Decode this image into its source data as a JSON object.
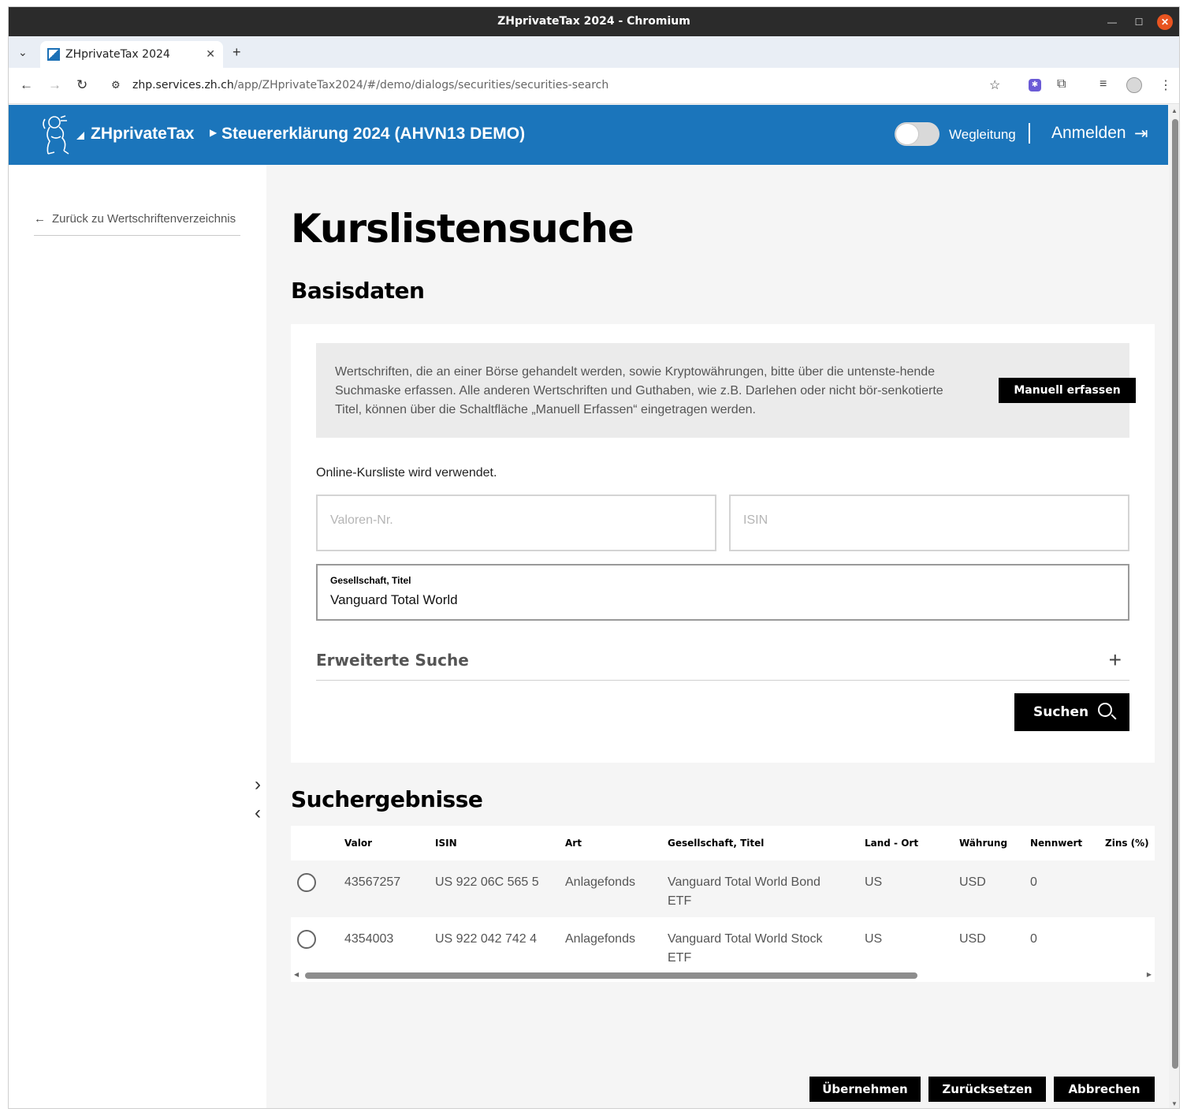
{
  "window": {
    "title": "ZHprivateTax 2024 - Chromium"
  },
  "browser": {
    "tab_title": "ZHprivateTax 2024",
    "url_host": "zhp.services.zh.ch",
    "url_path": "/app/ZHprivateTax2024/#/demo/dialogs/securities/securities-search"
  },
  "header": {
    "brand": "ZHprivateTax",
    "breadcrumb": "Steuererklärung 2024 (AHVN13 DEMO)",
    "wegleitung": "Wegleitung",
    "login": "Anmelden"
  },
  "sidebar": {
    "back_link": "Zurück zu Wertschriftenverzeichnis"
  },
  "main": {
    "title": "Kurslistensuche",
    "basis_heading": "Basisdaten",
    "info_text": "Wertschriften, die an einer Börse gehandelt werden, sowie Kryptowährungen, bitte über die untenste-hende Suchmaske erfassen. Alle anderen Wertschriften und Guthaben, wie z.B. Darlehen oder nicht bör-senkotierte Titel, können über die Schaltfläche „Manuell Erfassen“ eingetragen werden.",
    "manuell_button": "Manuell erfassen",
    "kursliste_note": "Online-Kursliste wird verwendet.",
    "valor_placeholder": "Valoren-Nr.",
    "isin_placeholder": "ISIN",
    "company_label": "Gesellschaft, Titel",
    "company_value": "Vanguard Total World",
    "advanced_search": "Erweiterte Suche",
    "search_button": "Suchen",
    "results_heading": "Suchergebnisse"
  },
  "results": {
    "columns": [
      "Valor",
      "ISIN",
      "Art",
      "Gesellschaft, Titel",
      "Land - Ort",
      "Währung",
      "Nennwert",
      "Zins (%)"
    ],
    "rows": [
      {
        "valor": "43567257",
        "isin": "US 922 06C 565 5",
        "art": "Anlagefonds",
        "title_line1": "Vanguard Total World Bond",
        "title_line2": "ETF",
        "land": "US",
        "currency": "USD",
        "nominal": "0",
        "zins": ""
      },
      {
        "valor": "4354003",
        "isin": "US 922 042 742 4",
        "art": "Anlagefonds",
        "title_line1": "Vanguard Total World Stock",
        "title_line2": "ETF",
        "land": "US",
        "currency": "USD",
        "nominal": "0",
        "zins": ""
      }
    ]
  },
  "footer": {
    "apply": "Übernehmen",
    "reset": "Zurücksetzen",
    "cancel": "Abbrechen"
  },
  "colors": {
    "header_blue": "#1b75bb",
    "button_black": "#000000",
    "page_bg": "#f5f5f5"
  }
}
